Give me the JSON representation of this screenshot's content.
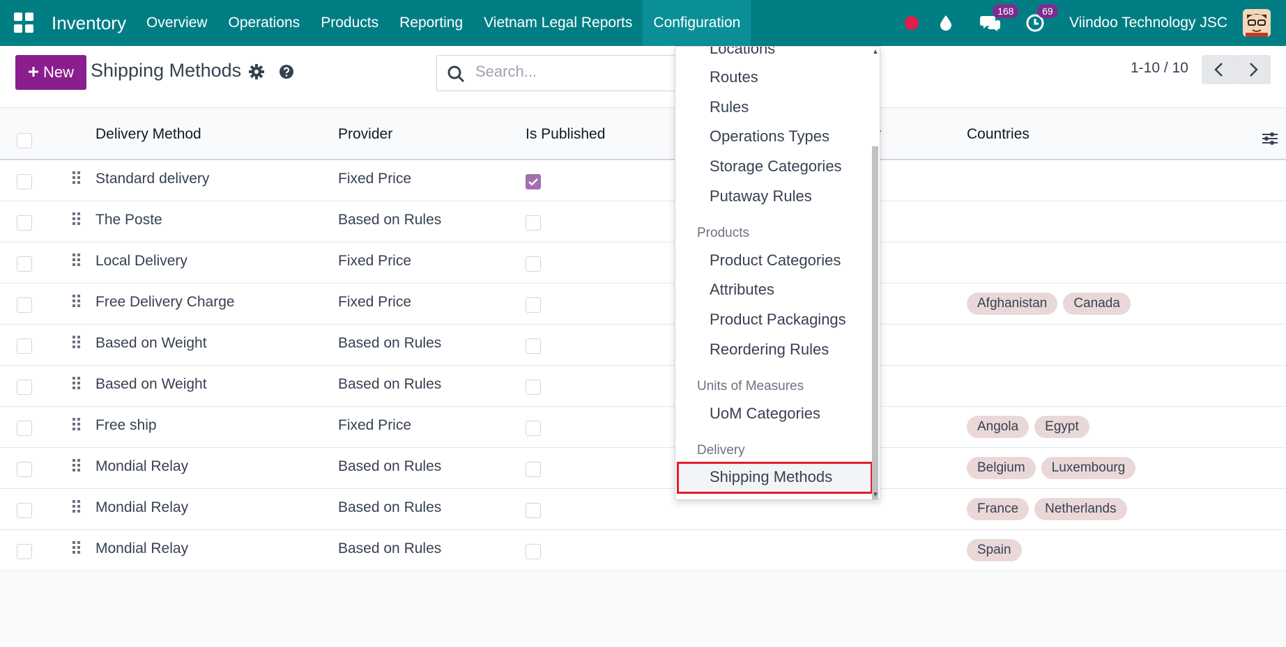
{
  "topbar": {
    "app_name": "Inventory",
    "menu": [
      "Overview",
      "Operations",
      "Products",
      "Reporting",
      "Vietnam Legal Reports",
      "Configuration"
    ],
    "messages_count": "168",
    "activities_count": "69",
    "company": "Viindoo Technology JSC"
  },
  "control": {
    "new_label": "New",
    "title": "Shipping Methods",
    "search_placeholder": "Search...",
    "pager": "1-10 / 10"
  },
  "table": {
    "headers": {
      "delivery_method": "Delivery Method",
      "provider": "Provider",
      "is_published": "Is Published",
      "company_fragment": "ny",
      "countries": "Countries"
    },
    "rows": [
      {
        "name": "Standard delivery",
        "provider": "Fixed Price",
        "published": true,
        "countries": []
      },
      {
        "name": "The Poste",
        "provider": "Based on Rules",
        "published": false,
        "countries": []
      },
      {
        "name": "Local Delivery",
        "provider": "Fixed Price",
        "published": false,
        "countries": []
      },
      {
        "name": "Free Delivery Charge",
        "provider": "Fixed Price",
        "published": false,
        "countries": [
          "Afghanistan",
          "Canada"
        ]
      },
      {
        "name": "Based on Weight",
        "provider": "Based on Rules",
        "published": false,
        "countries": []
      },
      {
        "name": "Based on Weight",
        "provider": "Based on Rules",
        "published": false,
        "countries": []
      },
      {
        "name": "Free ship",
        "provider": "Fixed Price",
        "published": false,
        "countries": [
          "Angola",
          "Egypt"
        ]
      },
      {
        "name": "Mondial Relay",
        "provider": "Based on Rules",
        "published": false,
        "countries": [
          "Belgium",
          "Luxembourg"
        ]
      },
      {
        "name": "Mondial Relay",
        "provider": "Based on Rules",
        "published": false,
        "countries": [
          "France",
          "Netherlands"
        ]
      },
      {
        "name": "Mondial Relay",
        "provider": "Based on Rules",
        "published": false,
        "countries": [
          "Spain"
        ]
      }
    ]
  },
  "dropdown": {
    "items_top": [
      "Locations",
      "Routes",
      "Rules",
      "Operations Types",
      "Storage Categories",
      "Putaway Rules"
    ],
    "products_header": "Products",
    "products_items": [
      "Product Categories",
      "Attributes",
      "Product Packagings",
      "Reordering Rules"
    ],
    "uom_header": "Units of Measures",
    "uom_items": [
      "UoM Categories"
    ],
    "delivery_header": "Delivery",
    "delivery_items": [
      "Shipping Methods"
    ]
  },
  "colors": {
    "topbar": "#017e84",
    "primary_button": "#8a1e8e",
    "highlight_border": "#e01e2a"
  }
}
